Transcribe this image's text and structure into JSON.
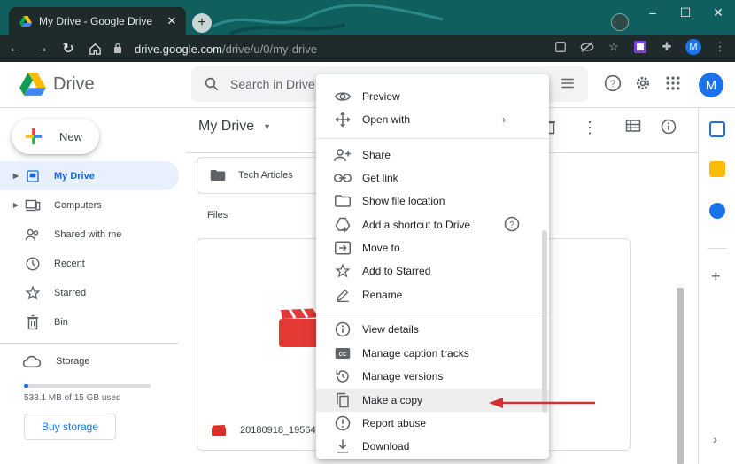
{
  "browser": {
    "tab_title": "My Drive - Google Drive",
    "tab_close": "✕",
    "new_tab": "+",
    "url_host": "drive.google.com",
    "url_path": "/drive/u/0/my-drive",
    "profile_initial": "M",
    "window_min": "–",
    "window_max": "☐",
    "window_close": "✕"
  },
  "header": {
    "app_name": "Drive",
    "search_placeholder": "Search in Drive",
    "account_initial": "M"
  },
  "sidebar": {
    "new_button": "New",
    "items": [
      {
        "label": "My Drive",
        "icon": "my-drive-icon",
        "active": true,
        "expandable": true
      },
      {
        "label": "Computers",
        "icon": "computers-icon",
        "active": false,
        "expandable": true
      },
      {
        "label": "Shared with me",
        "icon": "shared-icon",
        "active": false,
        "expandable": false
      },
      {
        "label": "Recent",
        "icon": "clock-icon",
        "active": false,
        "expandable": false
      },
      {
        "label": "Starred",
        "icon": "star-icon",
        "active": false,
        "expandable": false
      },
      {
        "label": "Bin",
        "icon": "trash-icon",
        "active": false,
        "expandable": false
      }
    ],
    "storage_label": "Storage",
    "storage_used_text": "533.1 MB of 15 GB used",
    "storage_used_fraction": 0.035,
    "buy_storage": "Buy storage"
  },
  "main": {
    "breadcrumb": "My Drive",
    "folders": [
      {
        "name": "Tech Articles"
      }
    ],
    "files_label": "Files",
    "files": [
      {
        "name": "20180918_195645",
        "type": "video"
      }
    ]
  },
  "context_menu": {
    "items": [
      {
        "label": "Preview",
        "icon": "eye-icon"
      },
      {
        "label": "Open with",
        "icon": "open-with-icon",
        "submenu": "›"
      },
      {
        "label": "Share",
        "icon": "person-add-icon"
      },
      {
        "label": "Get link",
        "icon": "link-icon"
      },
      {
        "label": "Show file location",
        "icon": "folder-icon"
      },
      {
        "label": "Add a shortcut to Drive",
        "icon": "add-shortcut-icon",
        "help": true
      },
      {
        "label": "Move to",
        "icon": "move-to-icon"
      },
      {
        "label": "Add to Starred",
        "icon": "star-outline-icon"
      },
      {
        "label": "Rename",
        "icon": "pencil-icon"
      },
      {
        "label": "View details",
        "icon": "info-icon"
      },
      {
        "label": "Manage caption tracks",
        "icon": "cc-icon"
      },
      {
        "label": "Manage versions",
        "icon": "history-icon"
      },
      {
        "label": "Make a copy",
        "icon": "copy-icon",
        "highlighted": true
      },
      {
        "label": "Report abuse",
        "icon": "report-icon"
      },
      {
        "label": "Download",
        "icon": "download-icon"
      }
    ]
  },
  "colors": {
    "accent": "#1a73e8",
    "active_nav_bg": "#e8f0fe",
    "annotation_arrow": "#d32f2f",
    "browser_tabbar": "#0f5f5e",
    "browser_toolbar": "#1f2b2b"
  }
}
